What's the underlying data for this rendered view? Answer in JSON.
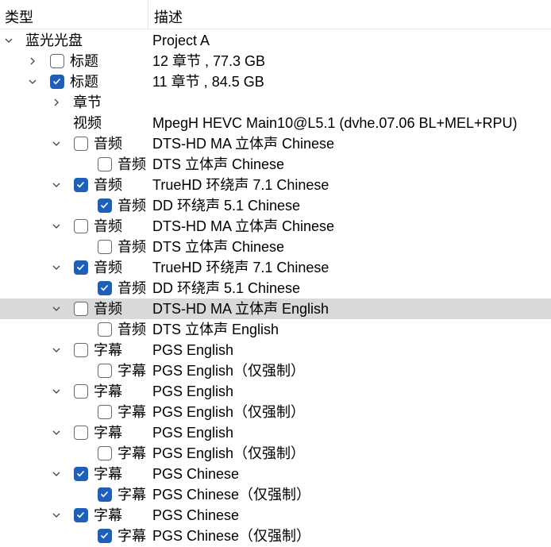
{
  "header": {
    "type_column": "类型",
    "desc_column": "描述"
  },
  "colors": {
    "checkbox_checked": "#1f5fb8",
    "selection": "#d9d9d9"
  },
  "rows": [
    {
      "level": 0,
      "chevron": "down",
      "checkbox": null,
      "type": "蓝光光盘",
      "desc": "Project A"
    },
    {
      "level": 1,
      "chevron": "right",
      "checkbox": false,
      "type": "标题",
      "desc": "12 章节 , 77.3 GB"
    },
    {
      "level": 1,
      "chevron": "down",
      "checkbox": true,
      "type": "标题",
      "desc": "11 章节 , 84.5 GB"
    },
    {
      "level": 2,
      "chevron": "right",
      "checkbox": null,
      "type": "章节",
      "desc": ""
    },
    {
      "level": 2,
      "chevron": null,
      "checkbox": null,
      "type": "视频",
      "desc": "MpegH HEVC Main10@L5.1 (dvhe.07.06 BL+MEL+RPU)"
    },
    {
      "level": 2,
      "chevron": "down",
      "checkbox": false,
      "type": "音频",
      "desc": "DTS-HD MA 立体声 Chinese"
    },
    {
      "level": 3,
      "chevron": null,
      "checkbox": false,
      "type": "音频",
      "desc": "DTS 立体声 Chinese"
    },
    {
      "level": 2,
      "chevron": "down",
      "checkbox": true,
      "type": "音频",
      "desc": "TrueHD 环绕声 7.1 Chinese"
    },
    {
      "level": 3,
      "chevron": null,
      "checkbox": true,
      "type": "音频",
      "desc": "DD 环绕声 5.1 Chinese"
    },
    {
      "level": 2,
      "chevron": "down",
      "checkbox": false,
      "type": "音频",
      "desc": "DTS-HD MA 立体声 Chinese"
    },
    {
      "level": 3,
      "chevron": null,
      "checkbox": false,
      "type": "音频",
      "desc": "DTS 立体声 Chinese"
    },
    {
      "level": 2,
      "chevron": "down",
      "checkbox": true,
      "type": "音频",
      "desc": "TrueHD 环绕声 7.1 Chinese"
    },
    {
      "level": 3,
      "chevron": null,
      "checkbox": true,
      "type": "音频",
      "desc": "DD 环绕声 5.1 Chinese"
    },
    {
      "level": 2,
      "chevron": "down",
      "checkbox": false,
      "type": "音频",
      "desc": "DTS-HD MA 立体声 English",
      "selected": true
    },
    {
      "level": 3,
      "chevron": null,
      "checkbox": false,
      "type": "音频",
      "desc": "DTS 立体声 English"
    },
    {
      "level": 2,
      "chevron": "down",
      "checkbox": false,
      "type": "字幕",
      "desc": "PGS English"
    },
    {
      "level": 3,
      "chevron": null,
      "checkbox": false,
      "type": "字幕",
      "desc": "PGS English（仅强制）"
    },
    {
      "level": 2,
      "chevron": "down",
      "checkbox": false,
      "type": "字幕",
      "desc": "PGS English"
    },
    {
      "level": 3,
      "chevron": null,
      "checkbox": false,
      "type": "字幕",
      "desc": "PGS English（仅强制）"
    },
    {
      "level": 2,
      "chevron": "down",
      "checkbox": false,
      "type": "字幕",
      "desc": "PGS English"
    },
    {
      "level": 3,
      "chevron": null,
      "checkbox": false,
      "type": "字幕",
      "desc": "PGS English（仅强制）"
    },
    {
      "level": 2,
      "chevron": "down",
      "checkbox": true,
      "type": "字幕",
      "desc": "PGS Chinese"
    },
    {
      "level": 3,
      "chevron": null,
      "checkbox": true,
      "type": "字幕",
      "desc": "PGS Chinese（仅强制）"
    },
    {
      "level": 2,
      "chevron": "down",
      "checkbox": true,
      "type": "字幕",
      "desc": "PGS Chinese"
    },
    {
      "level": 3,
      "chevron": null,
      "checkbox": true,
      "type": "字幕",
      "desc": "PGS Chinese（仅强制）"
    }
  ]
}
